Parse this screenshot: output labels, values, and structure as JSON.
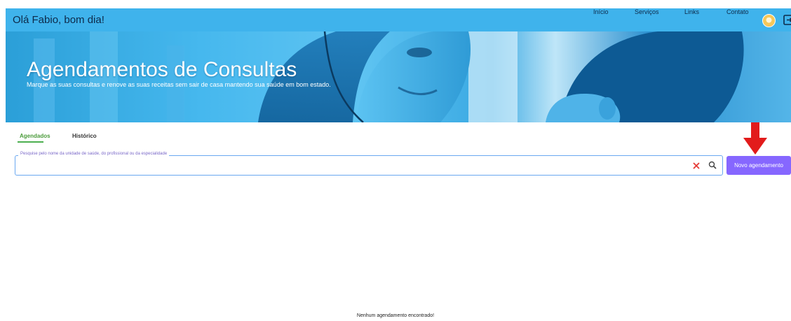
{
  "header": {
    "greeting": "Olá Fabio, bom dia!",
    "nav": [
      "Início",
      "Serviços",
      "Links",
      "Contato"
    ]
  },
  "hero": {
    "title": "Agendamentos de Consultas",
    "subtitle": "Marque as suas consultas e renove as suas receitas sem sair de casa mantendo sua saúde em bom estado."
  },
  "tabs": {
    "active": "Agendados",
    "inactive": "Histórico"
  },
  "search": {
    "label": "Pesquise pelo nome da unidade de saúde, do profissional ou da especialidade",
    "value": ""
  },
  "actions": {
    "new_appointment": "Novo agendamento"
  },
  "empty_message": "Nenhum agendamento encontrado!",
  "colors": {
    "topbar": "#3fb3ec",
    "primary_button": "#8667ff",
    "active_tab": "#4caf50",
    "annotation_arrow": "#e21b1b"
  }
}
